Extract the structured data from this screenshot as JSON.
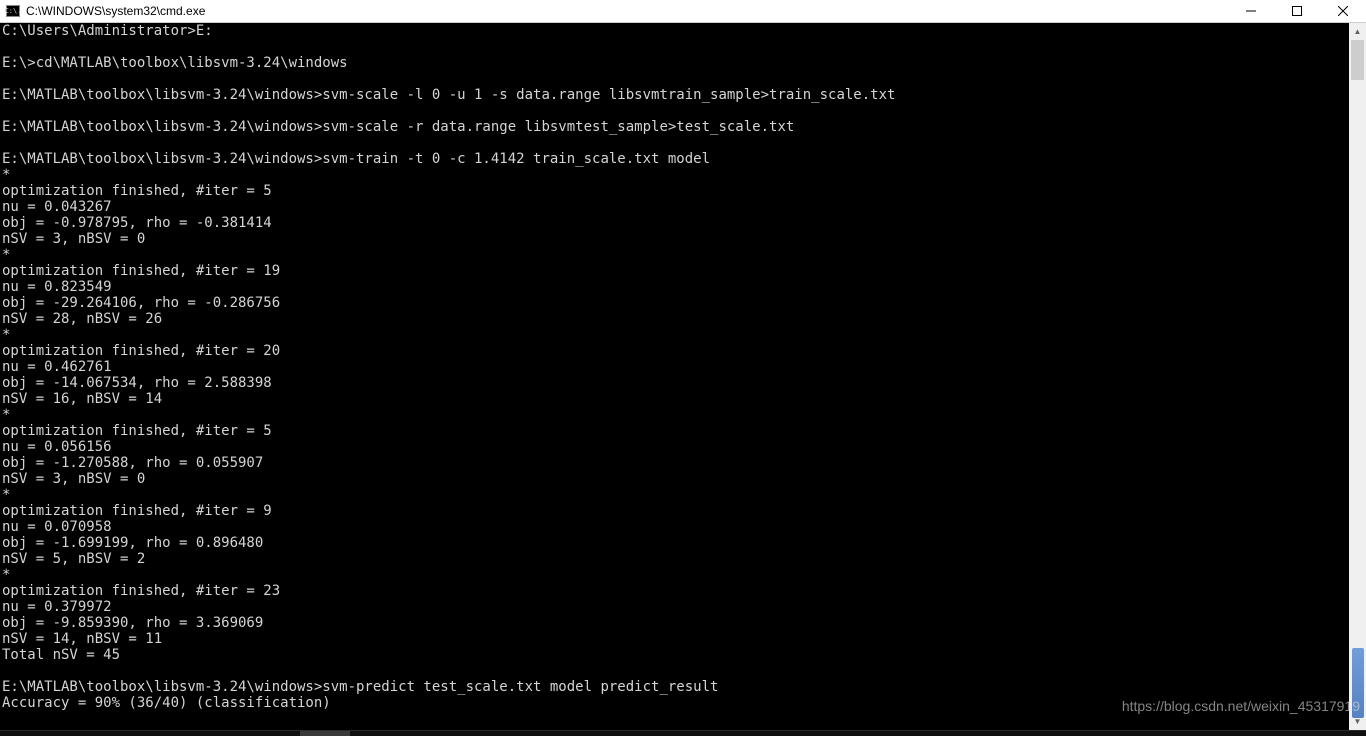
{
  "window": {
    "title": "C:\\WINDOWS\\system32\\cmd.exe",
    "icon_label": "C:\\."
  },
  "terminal": {
    "lines": [
      "C:\\Users\\Administrator>E:",
      "",
      "E:\\>cd\\MATLAB\\toolbox\\libsvm-3.24\\windows",
      "",
      "E:\\MATLAB\\toolbox\\libsvm-3.24\\windows>svm-scale -l 0 -u 1 -s data.range libsvmtrain_sample>train_scale.txt",
      "",
      "E:\\MATLAB\\toolbox\\libsvm-3.24\\windows>svm-scale -r data.range libsvmtest_sample>test_scale.txt",
      "",
      "E:\\MATLAB\\toolbox\\libsvm-3.24\\windows>svm-train -t 0 -c 1.4142 train_scale.txt model",
      "*",
      "optimization finished, #iter = 5",
      "nu = 0.043267",
      "obj = -0.978795, rho = -0.381414",
      "nSV = 3, nBSV = 0",
      "*",
      "optimization finished, #iter = 19",
      "nu = 0.823549",
      "obj = -29.264106, rho = -0.286756",
      "nSV = 28, nBSV = 26",
      "*",
      "optimization finished, #iter = 20",
      "nu = 0.462761",
      "obj = -14.067534, rho = 2.588398",
      "nSV = 16, nBSV = 14",
      "*",
      "optimization finished, #iter = 5",
      "nu = 0.056156",
      "obj = -1.270588, rho = 0.055907",
      "nSV = 3, nBSV = 0",
      "*",
      "optimization finished, #iter = 9",
      "nu = 0.070958",
      "obj = -1.699199, rho = 0.896480",
      "nSV = 5, nBSV = 2",
      "*",
      "optimization finished, #iter = 23",
      "nu = 0.379972",
      "obj = -9.859390, rho = 3.369069",
      "nSV = 14, nBSV = 11",
      "Total nSV = 45",
      "",
      "E:\\MATLAB\\toolbox\\libsvm-3.24\\windows>svm-predict test_scale.txt model predict_result",
      "Accuracy = 90% (36/40) (classification)"
    ]
  },
  "watermark": "https://blog.csdn.net/weixin_45317919"
}
